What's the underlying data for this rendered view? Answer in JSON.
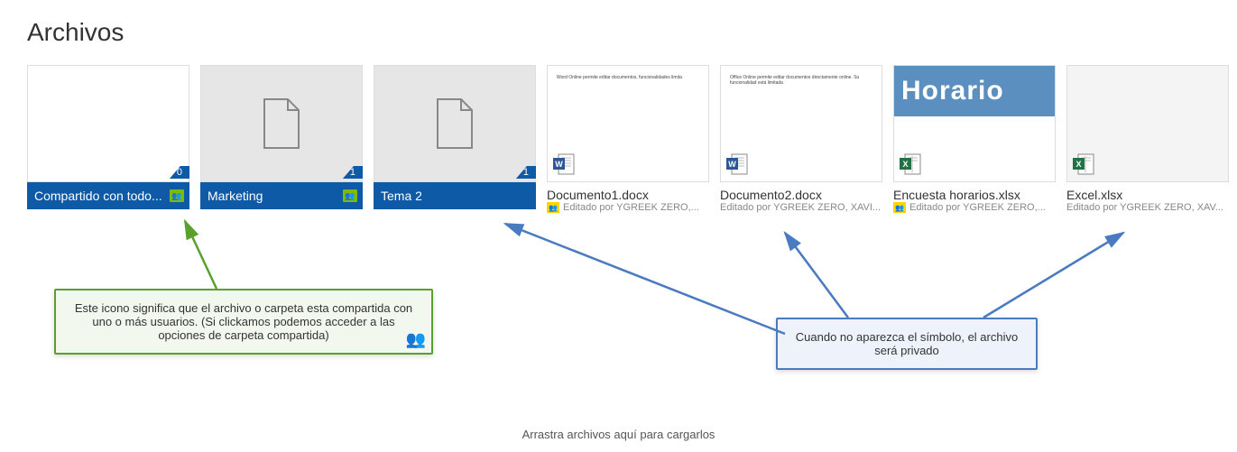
{
  "page": {
    "title": "Archivos",
    "drop_hint": "Arrastra archivos aquí para cargarlos"
  },
  "folders": [
    {
      "name": "Compartido con todo...",
      "count": "0",
      "shared": true
    },
    {
      "name": "Marketing",
      "count": "1",
      "shared": true
    },
    {
      "name": "Tema 2",
      "count": "1",
      "shared": false
    }
  ],
  "files": [
    {
      "name": "Documento1.docx",
      "subtitle": "Editado por YGREEK ZERO,...",
      "shared_badge": true,
      "app": "word",
      "preview_text": "Word Online permite editar documentos, funcionalidades limita",
      "header_band": ""
    },
    {
      "name": "Documento2.docx",
      "subtitle": "Editado por YGREEK ZERO, XAVI...",
      "shared_badge": false,
      "app": "word",
      "preview_text": "Office Online permite editar documentos directamente online. Su funcionalidad está limitada",
      "header_band": ""
    },
    {
      "name": "Encuesta horarios.xlsx",
      "subtitle": "Editado por YGREEK ZERO,...",
      "shared_badge": true,
      "app": "excel",
      "preview_text": "",
      "header_band": "Horario"
    },
    {
      "name": "Excel.xlsx",
      "subtitle": "Editado por YGREEK ZERO, XAV...",
      "shared_badge": false,
      "app": "excel",
      "preview_text": "",
      "header_band": ""
    }
  ],
  "callouts": {
    "green": "Este icono significa que el archivo o carpeta esta compartida con uno o más usuarios. (Si clickamos podemos acceder a las opciones de carpeta compartida)",
    "blue": "Cuando no aparezca el símbolo, el archivo será privado"
  },
  "icons": {
    "people": "👥"
  }
}
